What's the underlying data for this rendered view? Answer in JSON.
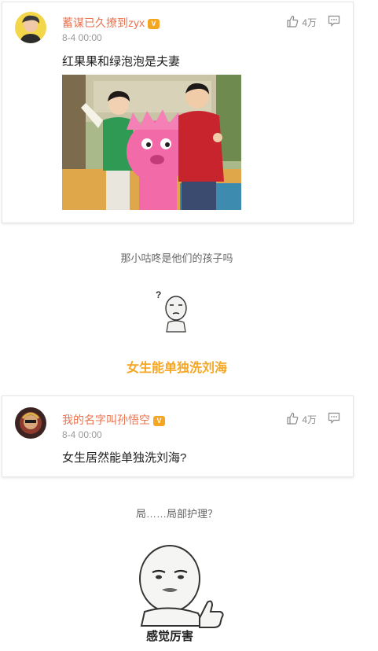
{
  "posts": [
    {
      "username": "蓄谋已久撩到zyx",
      "vip_badge": "V",
      "time": "8-4 00:00",
      "likes": "4万",
      "text": "红果果和绿泡泡是夫妻"
    },
    {
      "username": "我的名字叫孙悟空",
      "vip_badge": "V",
      "time": "8-4 00:00",
      "likes": "4万",
      "text": "女生居然能单独洗刘海?"
    }
  ],
  "captions": {
    "line1": "那小咕咚是他们的孩子吗",
    "highlight": "女生能单独洗刘海",
    "line3": "局……局部护理？"
  },
  "memes": {
    "question_mark": "?",
    "praise_text": "感觉厉害"
  },
  "colors": {
    "username": "#eb7350",
    "highlight": "#f5a623",
    "meta": "#999999"
  }
}
